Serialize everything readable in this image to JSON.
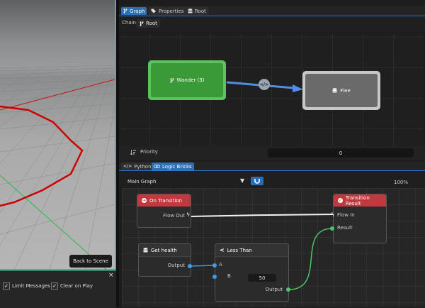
{
  "viewport": {
    "back_button": "Back to Scene"
  },
  "console": {
    "limit_messages": "Limit Messages",
    "clear_on_play": "Clear on Play",
    "close": "×",
    "check": "✓"
  },
  "top_tabs": [
    {
      "label": "Graph"
    },
    {
      "label": "Properties"
    },
    {
      "label": "Root"
    }
  ],
  "chain": {
    "label": "Chain:",
    "item": "Root"
  },
  "states": {
    "wander": {
      "label": "Wander (3)"
    },
    "flee": {
      "label": "Flee"
    },
    "transition_icon": "</>"
  },
  "priority": {
    "label": "Priority",
    "value": "0"
  },
  "bottom_tabs": [
    {
      "label": "Python"
    },
    {
      "label": "Logic Bricks"
    }
  ],
  "logic": {
    "graph_select": "Main Graph",
    "zoom": "100%",
    "nodes": {
      "on_transition": {
        "title": "On Transition",
        "port": "Flow Out"
      },
      "transition_result": {
        "title": "Transition Result",
        "flow_in": "Flow In",
        "result": "Result"
      },
      "get_health": {
        "title": "Get health",
        "output": "Output"
      },
      "less_than": {
        "title": "Less Than",
        "a": "A",
        "b": "B",
        "b_value": "50",
        "output": "Output"
      }
    }
  },
  "colors": {
    "accent": "#2b6fb4",
    "state_active": "#3fa33f",
    "state_inactive": "#6a6a6a",
    "node_red": "#c0393f",
    "socket_blue": "#3d9be9",
    "socket_green": "#4fc46a",
    "link_blue": "#4f8fe8"
  }
}
